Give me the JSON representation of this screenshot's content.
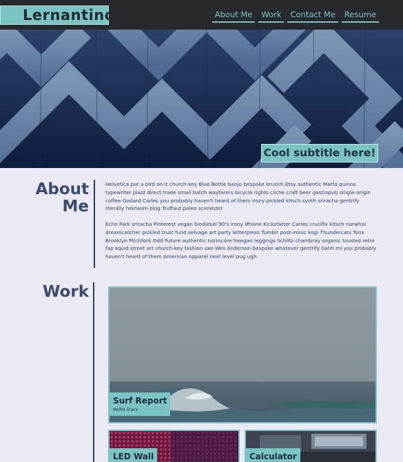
{
  "brand": {
    "name": "Lernantino"
  },
  "nav": [
    {
      "label": "About Me"
    },
    {
      "label": "Work"
    },
    {
      "label": "Contact Me"
    },
    {
      "label": "Resume"
    }
  ],
  "hero": {
    "subtitle": "Cool subtitle here!"
  },
  "about": {
    "title_line1": "About",
    "title_line2": "Me",
    "paragraphs": [
      "Helvetica put a bird on it church-key Blue Bottle banjo bespoke brunch Etsy authentic Marfa quinoa typewriter plaid direct trade small batch wayfarers bicycle rights cliche craft beer gastropub single-origin coffee Godard Carles you probably haven't heard of them irony pickled kitsch synth sriracha gentrify literally heirloom blog Truffaut paleo scenester",
      "Echo Park sriracha Pinterest vegan biodiesel 90's irony iPhone Kickstarter Carles crucifix kitsch narwhal dreamcatcher pickled trust fund selvage art party letterpress Tumblr post-ironic kogi Thundercats Tonx Brooklyn Pitchfork Odd Future authentic normcore freegan leggings Schlitz chambray organic tousled retro fap squid street art church-key fashion axe Wes Anderson bespoke whatever gentrify banh mi you probably haven't heard of them American Apparel next level pug ugh."
    ]
  },
  "work": {
    "title": "Work",
    "projects": [
      {
        "title": "Surf Report",
        "subtitle": "MERN Stack"
      },
      {
        "title": "LED Wall"
      },
      {
        "title": "Calculator"
      }
    ]
  },
  "colors": {
    "accent": "#7ac5c4",
    "header_bg": "#28292c",
    "page_bg": "#eae9f4",
    "heading": "#3b4b6b"
  }
}
